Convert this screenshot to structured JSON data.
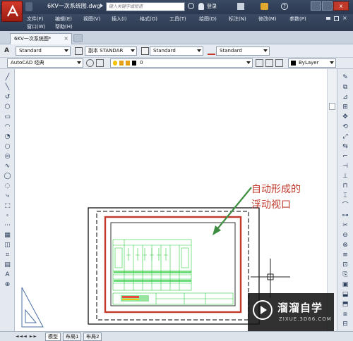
{
  "window": {
    "title": "6KV一次系统图.dwg",
    "search_placeholder": "键入关键字或短语",
    "login_label": "登录"
  },
  "menu": {
    "row1": [
      "文件(F)",
      "编辑(E)",
      "视图(V)",
      "插入(I)",
      "格式(O)",
      "工具(T)",
      "绘图(D)",
      "标注(N)",
      "修改(M)",
      "参数(P)"
    ],
    "row2": [
      "窗口(W)",
      "帮助(H)"
    ]
  },
  "tabs": {
    "active_doc": "6KV一次系统图*"
  },
  "toolbar1": {
    "text_style": "Standard",
    "dim_style": "副本 STANDAR",
    "table_style": "Standard",
    "mleader_style": "Standard"
  },
  "toolbar2": {
    "workspace": "AutoCAD 经典",
    "layer": "0",
    "color": "ByLayer"
  },
  "canvas": {
    "annotation_line1": "自动形成的",
    "annotation_line2": "浮动视口"
  },
  "layout_tabs": [
    "模型",
    "布局1",
    "布局2"
  ],
  "watermark": {
    "main_text": "溜溜自学",
    "sub_text": "ZIXUE.3D66.COM"
  },
  "colors": {
    "viewport_border": "#c0392b",
    "annotation": "#c0392b",
    "drawing": "#2ecc40",
    "arrow": "#3e8e41"
  }
}
